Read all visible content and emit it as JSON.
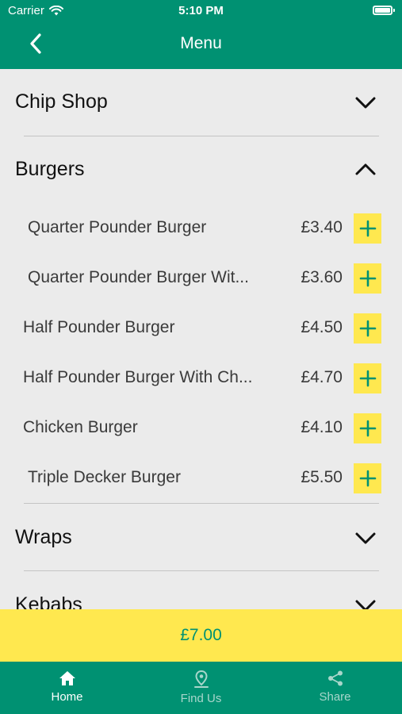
{
  "status_bar": {
    "carrier": "Carrier",
    "time": "5:10 PM"
  },
  "nav": {
    "title": "Menu"
  },
  "categories": [
    {
      "label": "Chip Shop",
      "expanded": false
    },
    {
      "label": "Burgers",
      "expanded": true
    },
    {
      "label": "Wraps",
      "expanded": false
    },
    {
      "label": "Kebabs",
      "expanded": false
    }
  ],
  "burger_items": [
    {
      "name": "Quarter Pounder Burger",
      "price": "£3.40"
    },
    {
      "name": "Quarter Pounder Burger Wit...",
      "price": "£3.60"
    },
    {
      "name": "Half Pounder Burger",
      "price": "£4.50"
    },
    {
      "name": "Half Pounder Burger With Ch...",
      "price": "£4.70"
    },
    {
      "name": "Chicken Burger",
      "price": "£4.10"
    },
    {
      "name": "Triple Decker Burger",
      "price": "£5.50"
    }
  ],
  "basket": {
    "total": "£7.00"
  },
  "tabs": [
    {
      "label": "Home",
      "icon": "home-icon",
      "active": true
    },
    {
      "label": "Find Us",
      "icon": "location-pin-icon",
      "active": false
    },
    {
      "label": "Share",
      "icon": "share-icon",
      "active": false
    }
  ],
  "colors": {
    "primary": "#009172",
    "accent": "#ffe84f",
    "background": "#ebebeb"
  }
}
